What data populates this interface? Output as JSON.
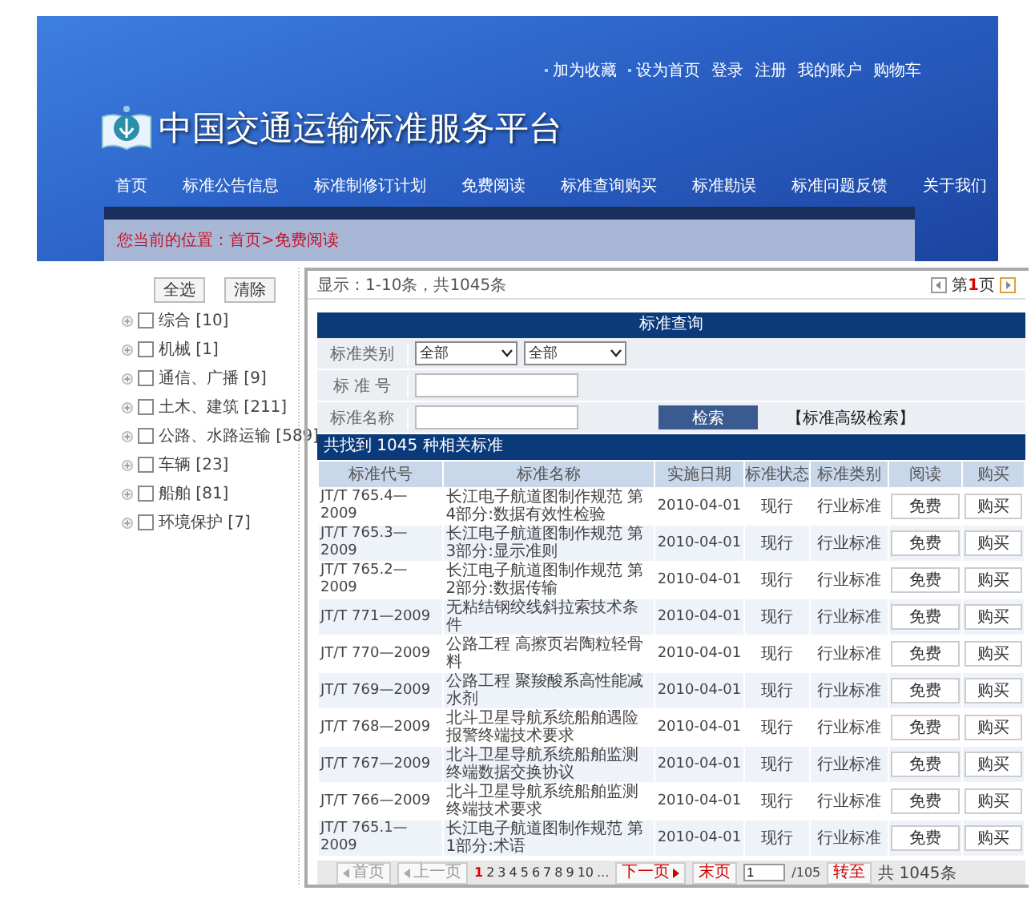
{
  "top_links": [
    {
      "label": "加为收藏",
      "kind": "bullet"
    },
    {
      "label": "设为首页",
      "kind": "bullet"
    },
    {
      "label": "登录",
      "kind": "plain"
    },
    {
      "label": "注册",
      "kind": "plain"
    },
    {
      "label": "我的账户",
      "kind": "plain"
    },
    {
      "label": "购物车",
      "kind": "plain"
    }
  ],
  "site_title": "中国交通运输标准服务平台",
  "nav": [
    "首页",
    "标准公告信息",
    "标准制修订计划",
    "免费阅读",
    "标准查询购买",
    "标准勘误",
    "标准问题反馈",
    "关于我们"
  ],
  "breadcrumb": "您当前的位置：首页>免费阅读",
  "sidebar": {
    "buttons": [
      "全选",
      "清除"
    ],
    "categories": [
      {
        "label": "综合 [10]",
        "checked": false
      },
      {
        "label": "机械 [1]",
        "checked": false
      },
      {
        "label": "通信、广播 [9]",
        "checked": false
      },
      {
        "label": "土木、建筑 [211]",
        "checked": false
      },
      {
        "label": "公路、水路运输 [589]",
        "checked": false
      },
      {
        "label": "车辆 [23]",
        "checked": false
      },
      {
        "label": "船舶 [81]",
        "checked": false
      },
      {
        "label": "环境保护 [7]",
        "checked": false
      }
    ]
  },
  "summary": "显示：1-10条，共1045条",
  "pager": {
    "prefix": "第",
    "number": "1",
    "suffix": "页"
  },
  "search": {
    "title": "标准查询",
    "fields": [
      {
        "label": "标准类别",
        "kind": "selects",
        "options": [
          "全部",
          "全部"
        ]
      },
      {
        "label": "标 准 号",
        "kind": "text"
      },
      {
        "label": "标准名称",
        "kind": "text"
      }
    ],
    "button": "检索",
    "advanced": "【标准高级检索】"
  },
  "found": "共找到  1045 种相关标准",
  "table": {
    "columns": [
      "标准代号",
      "标准名称",
      "实施日期",
      "标准状态",
      "标准类别",
      "阅读",
      "购买"
    ],
    "rows": [
      {
        "code": "JT/T 765.4—2009",
        "name": "长江电子航道图制作规范 第4部分:数据有效性检验",
        "date": "2010-04-01",
        "status": "现行",
        "category": "行业标准",
        "read": "免费",
        "buy": "购买"
      },
      {
        "code": "JT/T 765.3—2009",
        "name": "长江电子航道图制作规范 第3部分:显示准则",
        "date": "2010-04-01",
        "status": "现行",
        "category": "行业标准",
        "read": "免费",
        "buy": "购买"
      },
      {
        "code": "JT/T 765.2—2009",
        "name": "长江电子航道图制作规范 第2部分:数据传输",
        "date": "2010-04-01",
        "status": "现行",
        "category": "行业标准",
        "read": "免费",
        "buy": "购买"
      },
      {
        "code": "JT/T 771—2009",
        "name": "无粘结钢绞线斜拉索技术条件",
        "date": "2010-04-01",
        "status": "现行",
        "category": "行业标准",
        "read": "免费",
        "buy": "购买"
      },
      {
        "code": "JT/T 770—2009",
        "name": "公路工程 高擦页岩陶粒轻骨料",
        "date": "2010-04-01",
        "status": "现行",
        "category": "行业标准",
        "read": "免费",
        "buy": "购买"
      },
      {
        "code": "JT/T 769—2009",
        "name": "公路工程 聚羧酸系高性能减水剂",
        "date": "2010-04-01",
        "status": "现行",
        "category": "行业标准",
        "read": "免费",
        "buy": "购买"
      },
      {
        "code": "JT/T 768—2009",
        "name": "北斗卫星导航系统船舶遇险报警终端技术要求",
        "date": "2010-04-01",
        "status": "现行",
        "category": "行业标准",
        "read": "免费",
        "buy": "购买"
      },
      {
        "code": "JT/T 767—2009",
        "name": "北斗卫星导航系统船舶监测终端数据交换协议",
        "date": "2010-04-01",
        "status": "现行",
        "category": "行业标准",
        "read": "免费",
        "buy": "购买"
      },
      {
        "code": "JT/T 766—2009",
        "name": "北斗卫星导航系统船舶监测终端技术要求",
        "date": "2010-04-01",
        "status": "现行",
        "category": "行业标准",
        "read": "免费",
        "buy": "购买"
      },
      {
        "code": "JT/T 765.1—2009",
        "name": "长江电子航道图制作规范 第1部分:术语",
        "date": "2010-04-01",
        "status": "现行",
        "category": "行业标准",
        "read": "免费",
        "buy": "购买"
      }
    ]
  },
  "pagination": {
    "first": "首页",
    "prev": "上一页",
    "pages": [
      {
        "label": "1",
        "selected": true
      },
      {
        "label": "2",
        "selected": false
      },
      {
        "label": "3",
        "selected": false
      },
      {
        "label": "4",
        "selected": false
      },
      {
        "label": "5",
        "selected": false
      },
      {
        "label": "6",
        "selected": false
      },
      {
        "label": "7",
        "selected": false
      },
      {
        "label": "8",
        "selected": false
      },
      {
        "label": "9",
        "selected": false
      },
      {
        "label": "10",
        "selected": false
      }
    ],
    "ellipsis": "...",
    "next": "下一页",
    "last": "末页",
    "page_input": "1",
    "total_pages": "/105",
    "go": "转至",
    "count": "共 1045条"
  }
}
